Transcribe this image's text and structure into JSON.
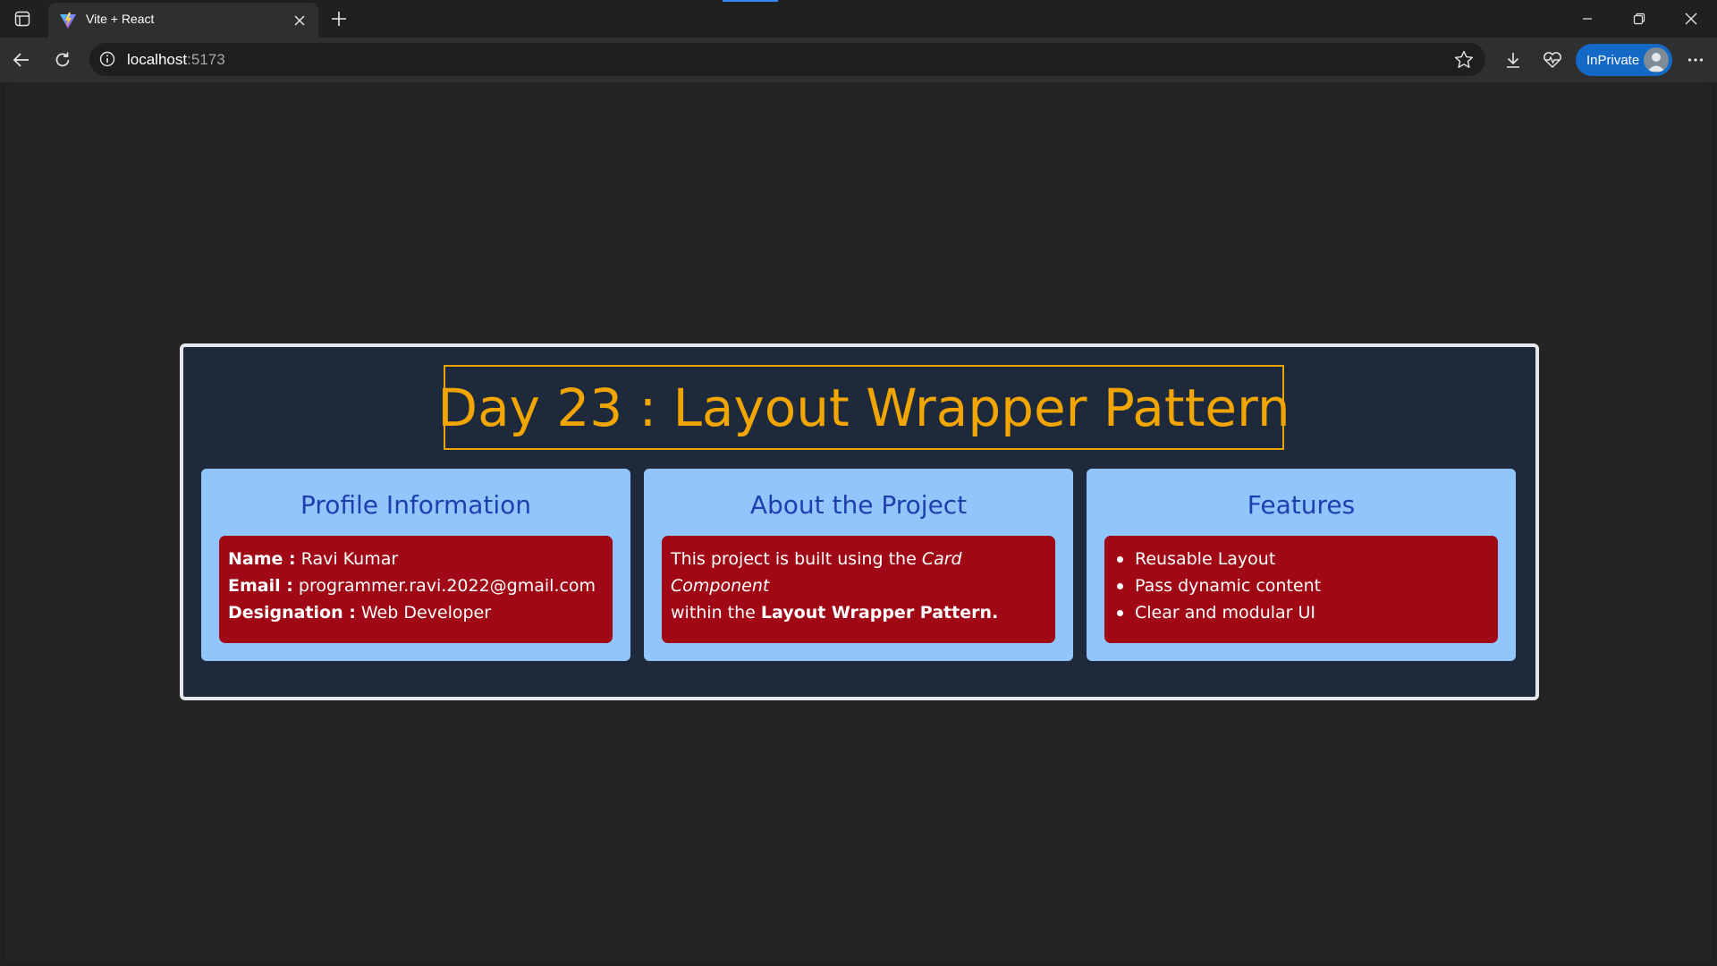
{
  "browser": {
    "tab": {
      "title": "Vite + React"
    },
    "address": {
      "host": "localhost",
      "port": ":5173"
    },
    "inprivate_label": "InPrivate",
    "colors": {
      "accent": "#1469c7",
      "tab_bg": "#2f2f2f"
    }
  },
  "page": {
    "heading": "Day 23 : Layout Wrapper Pattern",
    "cards": [
      {
        "title": "Profile Information",
        "fields": [
          {
            "label": "Name :",
            "value": "Ravi Kumar"
          },
          {
            "label": "Email :",
            "value": "programmer.ravi.2022@gmail.com"
          },
          {
            "label": "Designation :",
            "value": "Web Developer"
          }
        ]
      },
      {
        "title": "About the Project",
        "text_prefix": "This project is built using the ",
        "text_italic": "Card Component",
        "text_middle": "within the ",
        "text_bold": "Layout Wrapper Pattern."
      },
      {
        "title": "Features",
        "items": [
          "Reusable Layout",
          "Pass dynamic content",
          "Clear and modular UI"
        ]
      }
    ],
    "colors": {
      "wrapper_bg": "#1e2a3b",
      "heading": "#f0a500",
      "card_bg": "#93c5fd",
      "card_title": "#1e40af",
      "card_body": "#a00815"
    }
  }
}
